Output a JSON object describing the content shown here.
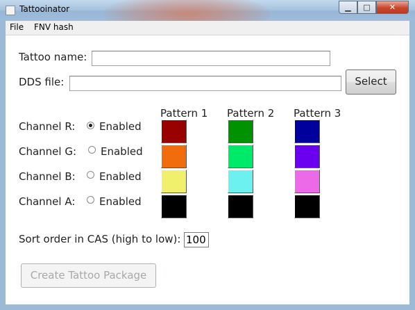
{
  "window": {
    "title": "Tattooinator"
  },
  "controls": {
    "minimize": "▁",
    "maximize": "□",
    "close": "✕"
  },
  "menu": [
    "File",
    "FNV hash"
  ],
  "form": {
    "tattoo_name_label": "Tattoo name:",
    "tattoo_name_value": "",
    "dds_file_label": "DDS file:",
    "dds_file_value": "",
    "select_label": "Select",
    "pattern_headers": [
      "Pattern 1",
      "Pattern 2",
      "Pattern 3"
    ],
    "channels": [
      {
        "label": "Channel R:",
        "option": "Enabled",
        "checked": true,
        "colors": [
          "#990000",
          "#009200",
          "#00009c"
        ]
      },
      {
        "label": "Channel G:",
        "option": "Enabled",
        "checked": false,
        "colors": [
          "#f06c0c",
          "#00ea6a",
          "#6b00f0"
        ]
      },
      {
        "label": "Channel B:",
        "option": "Enabled",
        "checked": false,
        "colors": [
          "#f0f06c",
          "#6cf0f0",
          "#ec6ae8"
        ]
      },
      {
        "label": "Channel A:",
        "option": "Enabled",
        "checked": false,
        "colors": [
          "#000000",
          "#000000",
          "#000000"
        ]
      }
    ],
    "sort_label": "Sort order in CAS (high to low):",
    "sort_value": "100",
    "create_label": "Create Tattoo Package"
  }
}
